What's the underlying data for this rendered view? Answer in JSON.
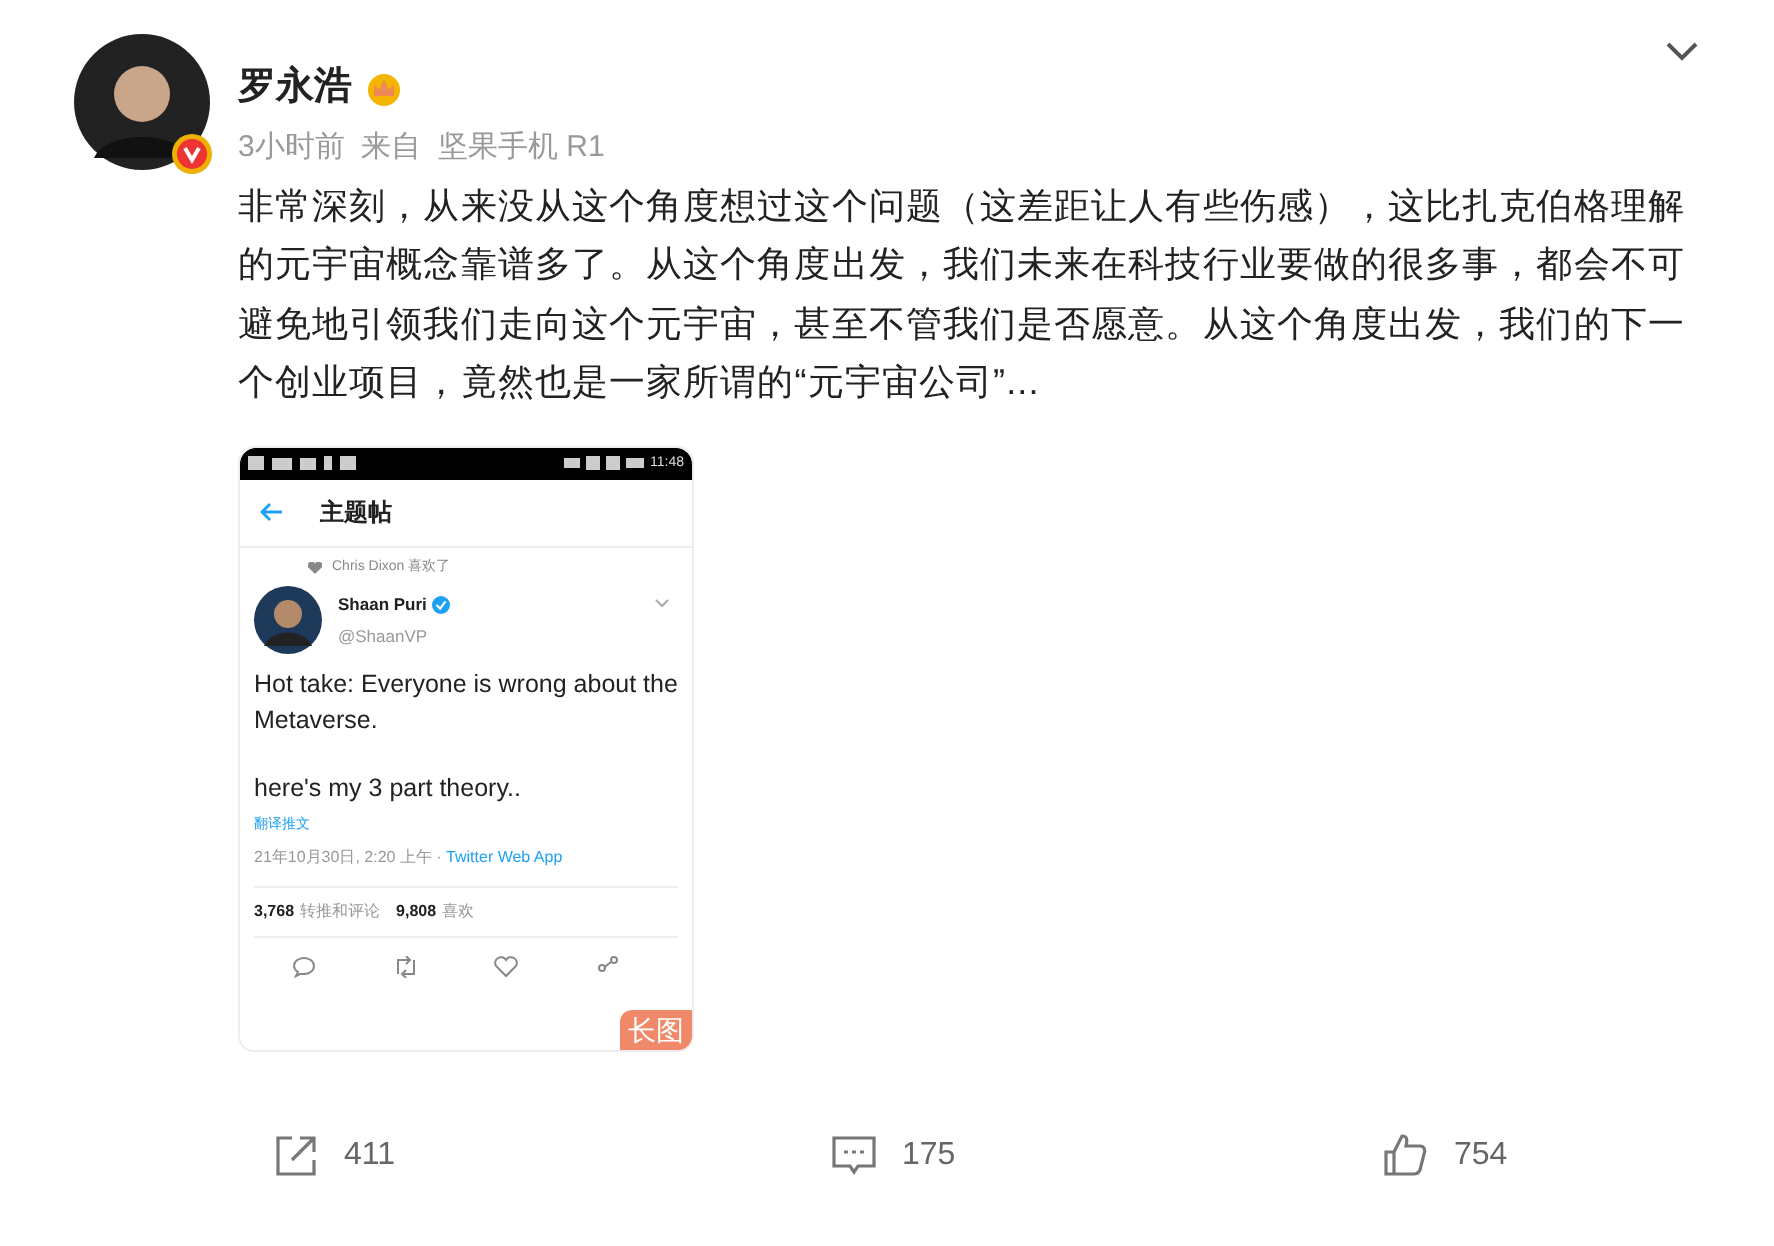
{
  "post": {
    "author": "罗永浩",
    "meta": "3小时前  来自  坚果手机 R1",
    "body": "非常深刻，从来没从这个角度想过这个问题（这差距让人有些伤感），这比扎克伯格理解的元宇宙概念靠谱多了。从这个角度出发，我们未来在科技行业要做的很多事，都会不可避免地引领我们走向这个元宇宙，甚至不管我们是否愿意。从这个角度出发，我们的下一个创业项目，竟然也是一家所谓的“元宇宙公司”..."
  },
  "embedded_screenshot": {
    "status_time": "11:48",
    "header_title": "主题帖",
    "liked_by": "Chris Dixon 喜欢了",
    "tweet_author": "Shaan Puri",
    "tweet_handle": "@ShaanVP",
    "tweet_lines": [
      "Hot take: Everyone is wrong about the Metaverse.",
      "here's my 3 part theory.."
    ],
    "translate": "翻译推文",
    "date": "21年10月30日, 2:20 上午 · ",
    "source": "Twitter Web App",
    "retweets_count": "3,768",
    "retweets_label": "转推和评论",
    "likes_count": "9,808",
    "likes_label": "喜欢",
    "badge": "长图"
  },
  "actions": [
    {
      "kind": "share",
      "count": "411"
    },
    {
      "kind": "comment",
      "count": "175"
    },
    {
      "kind": "like",
      "count": "754"
    }
  ]
}
